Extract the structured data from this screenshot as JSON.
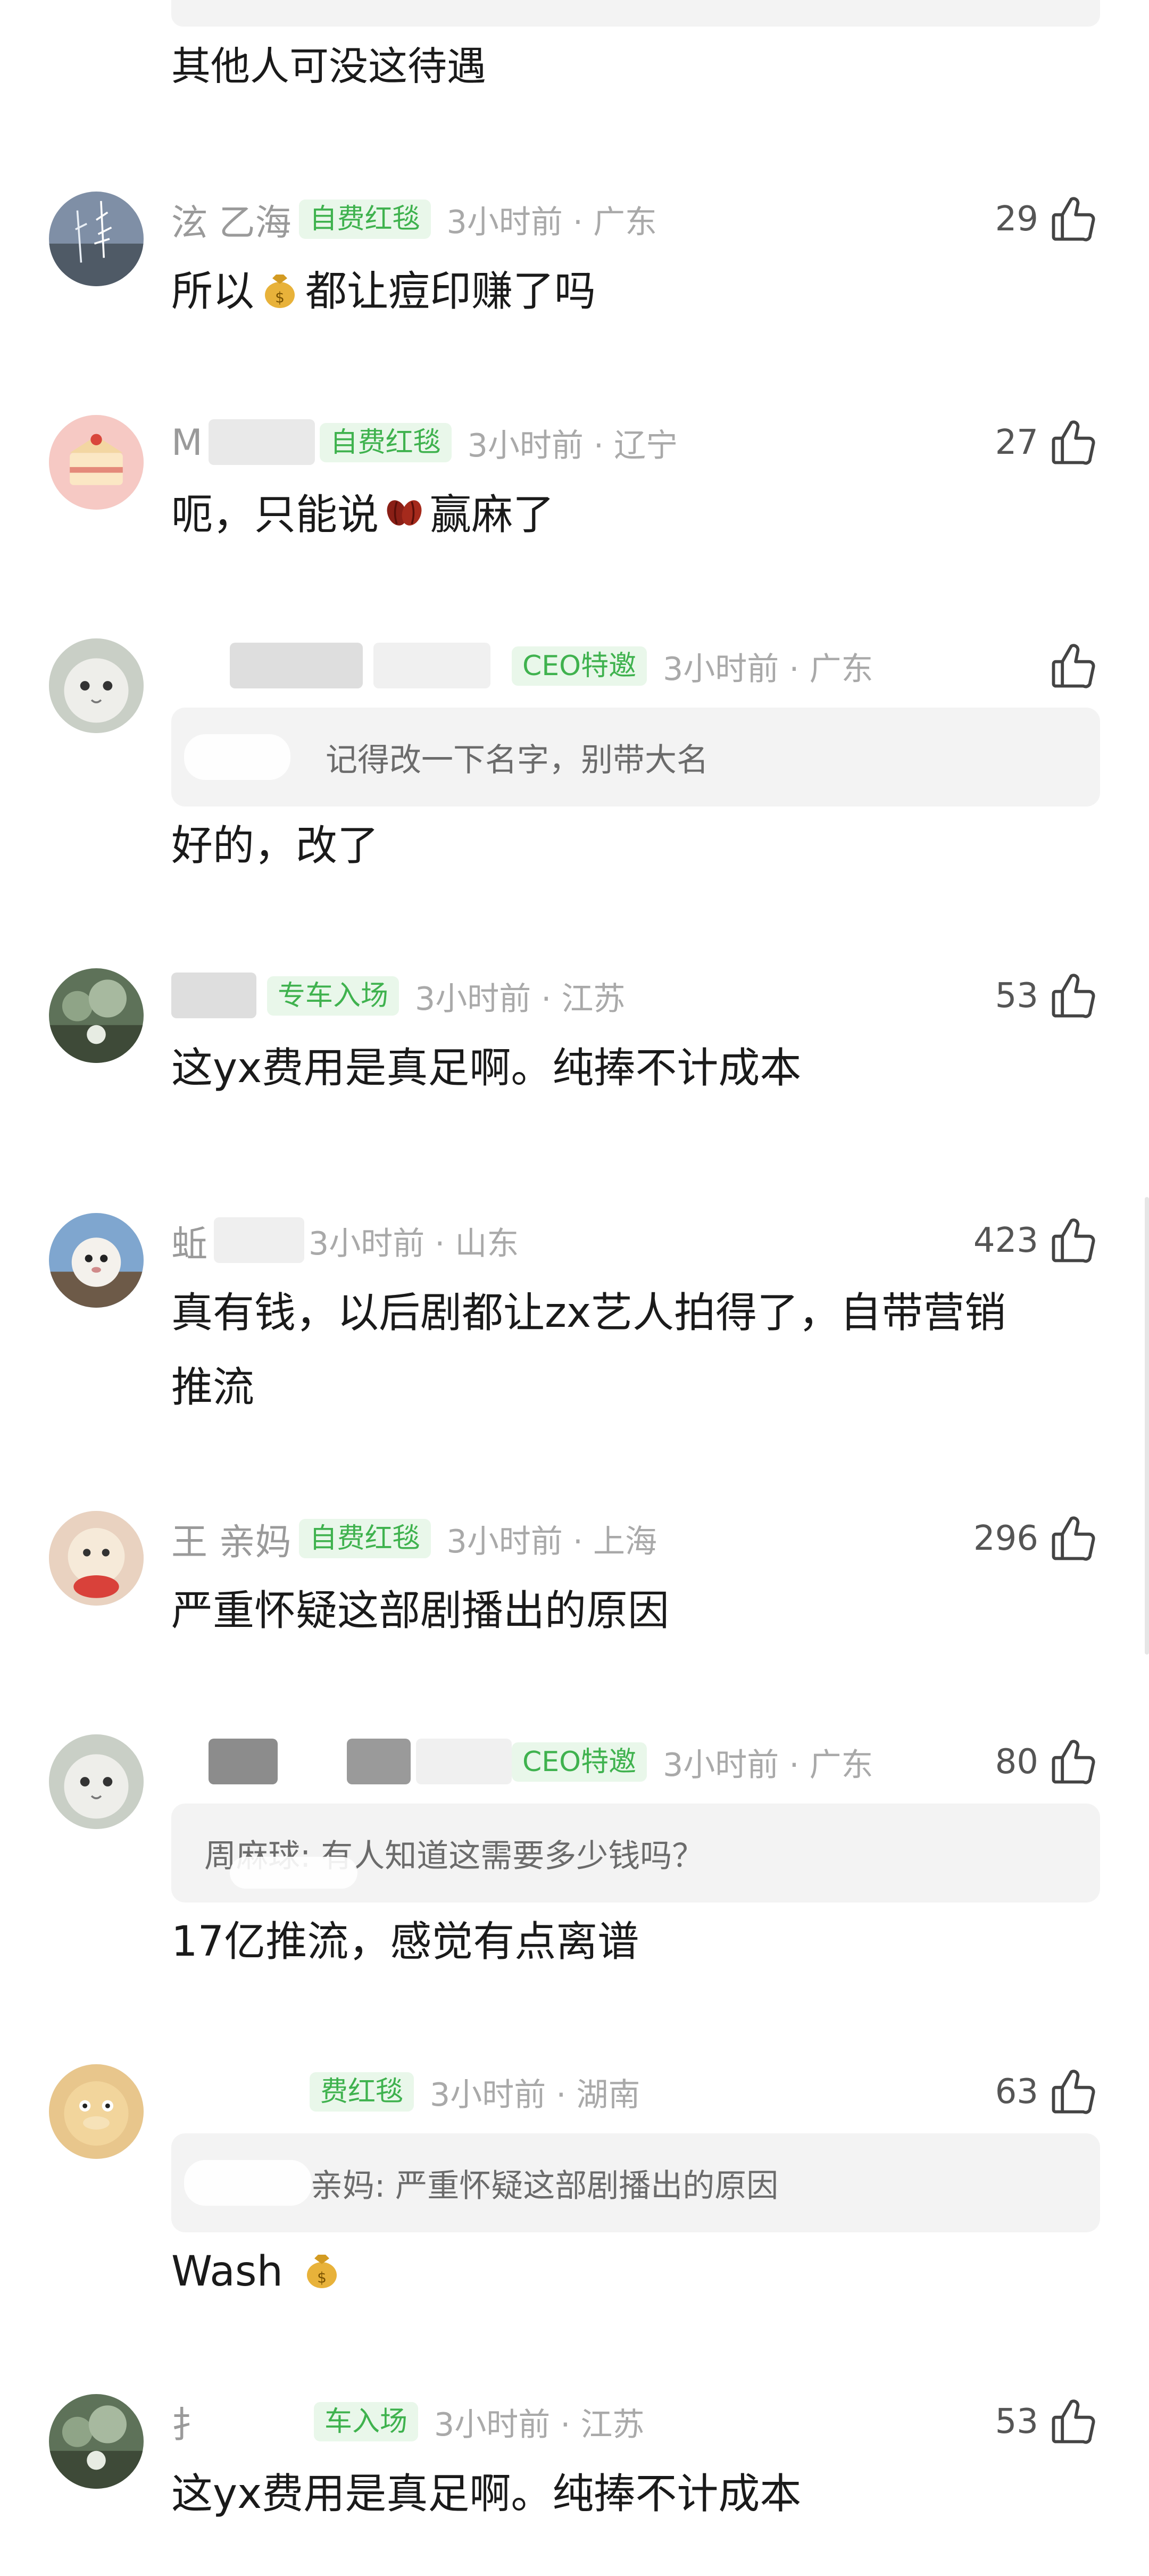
{
  "top": {
    "text": "其他人可没这待遇"
  },
  "comments": [
    {
      "username": "泫 乙海",
      "badge": "自费红毯",
      "time": "3小时前 · 广东",
      "likes": "29",
      "text_before": "所以",
      "emoji": "money-bag-icon",
      "text_after": "都让痘印赚了吗"
    },
    {
      "username": "M",
      "badge": "自费红毯",
      "time": "3小时前 · 辽宁",
      "likes": "27",
      "text_before": "呃，只能说",
      "emoji": "beans-icon",
      "text_after": "赢麻了"
    },
    {
      "username": "",
      "badge": "CEO特邀",
      "time": "3小时前 · 广东",
      "likes": "",
      "quote": "记得改一下名字，别带大名",
      "text": "好的，改了"
    },
    {
      "username": "",
      "badge": "专车入场",
      "time": "3小时前 · 江苏",
      "likes": "53",
      "text": "这yx费用是真足啊。纯捧不计成本"
    },
    {
      "username": "蚯",
      "badge": "",
      "time": "3小时前 · 山东",
      "likes": "423",
      "text_line1": "真有钱，以后剧都让zx艺人拍得了，自带营销",
      "text_line2": "推流"
    },
    {
      "username": "王 亲妈",
      "badge": "自费红毯",
      "time": "3小时前 · 上海",
      "likes": "296",
      "text": "严重怀疑这部剧播出的原因"
    },
    {
      "username": "",
      "badge": "CEO特邀",
      "time": "3小时前 · 广东",
      "likes": "80",
      "quote": "周麻球: 有人知道这需要多少钱吗？",
      "text": "17亿推流，感觉有点离谱"
    },
    {
      "username": "",
      "badge": "费红毯",
      "time": "3小时前 · 湖南",
      "likes": "63",
      "quote": "亲妈: 严重怀疑这部剧播出的原因",
      "text": "Wash",
      "emoji": "money-bag-icon"
    },
    {
      "username": "扌",
      "badge": "车入场",
      "time": "3小时前 · 江苏",
      "likes": "53",
      "text": "这yx费用是真足啊。纯捧不计成本"
    }
  ],
  "colors": {
    "badge_text": "#3fb24e",
    "badge_bg": "#e9f7ea",
    "meta_gray": "#a9a9a9",
    "quote_bg": "#f3f3f3"
  }
}
